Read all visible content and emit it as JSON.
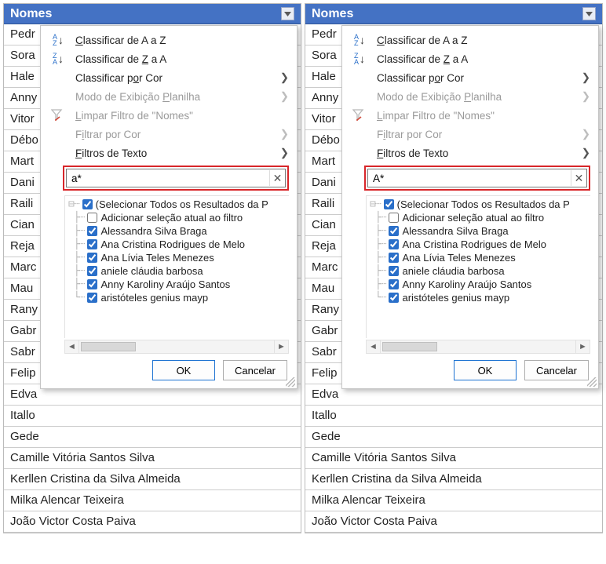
{
  "panels": [
    {
      "search_value": "a*"
    },
    {
      "search_value": "A*"
    }
  ],
  "header": {
    "title": "Nomes"
  },
  "menu": {
    "sort_az": "Classificar de A a Z",
    "sort_za": "Classificar de Z a A",
    "sort_color": "Classificar por Cor",
    "view_sheet": "Modo de Exibição Planilha",
    "clear_filter": "Limpar Filtro de \"Nomes\"",
    "filter_color": "Filtrar por Cor",
    "text_filters": "Filtros de Texto"
  },
  "tree": {
    "select_all": "(Selecionar Todos os Resultados da P",
    "add_current": "Adicionar seleção atual ao filtro",
    "items": [
      "Alessandra Silva Braga",
      "Ana Cristina Rodrigues de Melo",
      "Ana Lívia Teles Menezes",
      "aniele cláudia barbosa",
      "Anny Karoliny Araújo Santos",
      "aristóteles genius mayp"
    ]
  },
  "buttons": {
    "ok": "OK",
    "cancel": "Cancelar"
  },
  "rows_behind": [
    "Pedr",
    "Sora",
    "Hale",
    "Anny",
    "Vitor",
    "Débo",
    "Mart",
    "Dani",
    "Raili",
    "Cian",
    "Reja",
    "Marc",
    "Mau",
    "Rany",
    "Gabr",
    "Sabr",
    "Felip",
    "Edva",
    "Itallo",
    "Gede"
  ],
  "rows_bottom": [
    "Camille Vitória Santos Silva",
    "Kerllen Cristina da Silva Almeida",
    "Milka Alencar Teixeira",
    "João Victor Costa Paiva"
  ]
}
